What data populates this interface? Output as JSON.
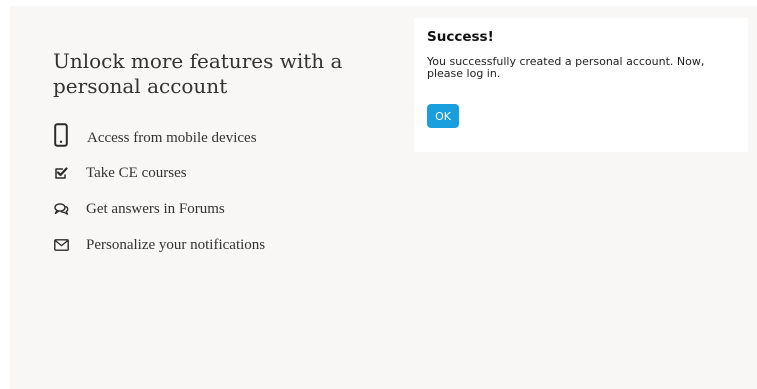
{
  "features": {
    "heading": "Unlock more features with a personal account",
    "items": [
      {
        "icon": "mobile-phone-icon",
        "label": "Access from mobile devices"
      },
      {
        "icon": "checkbox-checked-icon",
        "label": "Take CE courses"
      },
      {
        "icon": "chat-bubbles-icon",
        "label": "Get answers in Forums"
      },
      {
        "icon": "envelope-icon",
        "label": "Personalize your notifications"
      }
    ]
  },
  "dialog": {
    "title": "Success!",
    "message": "You successfully created a personal account. Now, please log in.",
    "ok_label": "OK"
  },
  "colors": {
    "background": "#f8f7f6",
    "dialog_background": "#ffffff",
    "button": "#1a9fde",
    "text": "#333333"
  }
}
